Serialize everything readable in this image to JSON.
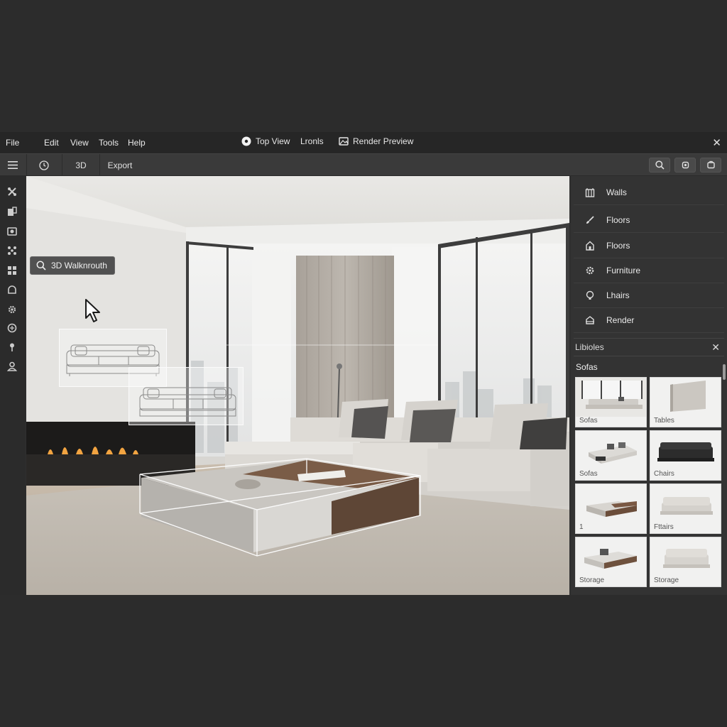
{
  "menubar": {
    "items": [
      "File",
      "Edit",
      "View",
      "Tools",
      "Help"
    ],
    "center": [
      {
        "label": "Top View",
        "icon": "disc-icon"
      },
      {
        "label": "Lronls",
        "icon": ""
      },
      {
        "label": "Render Preview",
        "icon": "image-frame-icon"
      }
    ]
  },
  "toolbar": {
    "menu_icon": "hamburger-icon",
    "clock_icon": "clock-icon",
    "mode_3d": "3D",
    "export": "Export",
    "right_icons": [
      "search-icon",
      "settings-icon",
      "cube-icon"
    ]
  },
  "rail": {
    "icons": [
      "tools-icon",
      "walls-icon",
      "camera-icon",
      "nodes-icon",
      "grid-icon",
      "dome-icon",
      "gear-icon",
      "globe-icon",
      "pin-icon",
      "user-icon"
    ]
  },
  "viewport": {
    "walkthrough_label": "3D Walknrouth"
  },
  "panel": {
    "items": [
      {
        "label": "Walls",
        "icon": "walls-icon"
      },
      {
        "label": "Floors",
        "icon": "brush-icon"
      },
      {
        "label": "Floors",
        "icon": "home-icon"
      },
      {
        "label": "Furniture",
        "icon": "gear-icon"
      },
      {
        "label": "Lhairs",
        "icon": "bulb-icon"
      },
      {
        "label": "Render",
        "icon": "render-icon"
      }
    ],
    "library_title": "Libioles",
    "library_subtitle": "Sofas",
    "cards": [
      {
        "label": "Sofas",
        "thumb": "room"
      },
      {
        "label": "Tables",
        "thumb": "panel"
      },
      {
        "label": "Sofas",
        "thumb": "sectional"
      },
      {
        "label": "Chairs",
        "thumb": "dark-sofa"
      },
      {
        "label": "1",
        "thumb": "ottoman"
      },
      {
        "label": "Fttairs",
        "thumb": "sofa"
      },
      {
        "label": "Storage",
        "thumb": "bench"
      },
      {
        "label": "Storage",
        "thumb": "loveseat"
      }
    ]
  }
}
